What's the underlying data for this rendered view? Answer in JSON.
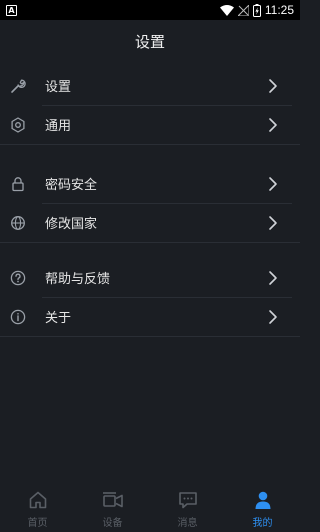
{
  "status": {
    "time": "11:25",
    "notification_letter": "A"
  },
  "header": {
    "title": "设置"
  },
  "groups": [
    {
      "items": [
        {
          "label": "设置",
          "icon": "wrench-icon"
        },
        {
          "label": "通用",
          "icon": "gear-icon"
        }
      ]
    },
    {
      "items": [
        {
          "label": "密码安全",
          "icon": "lock-icon"
        },
        {
          "label": "修改国家",
          "icon": "globe-icon"
        }
      ]
    },
    {
      "items": [
        {
          "label": "帮助与反馈",
          "icon": "help-icon"
        },
        {
          "label": "关于",
          "icon": "info-icon"
        }
      ]
    }
  ],
  "tabs": [
    {
      "label": "首页",
      "icon": "home-icon"
    },
    {
      "label": "设备",
      "icon": "device-icon"
    },
    {
      "label": "消息",
      "icon": "message-icon"
    },
    {
      "label": "我的",
      "icon": "user-icon",
      "active": true
    }
  ],
  "colors": {
    "background": "#1b1e23",
    "accent": "#2e8ff0",
    "icon_inactive": "#5a5f66",
    "icon_row": "#9aa0a8"
  }
}
